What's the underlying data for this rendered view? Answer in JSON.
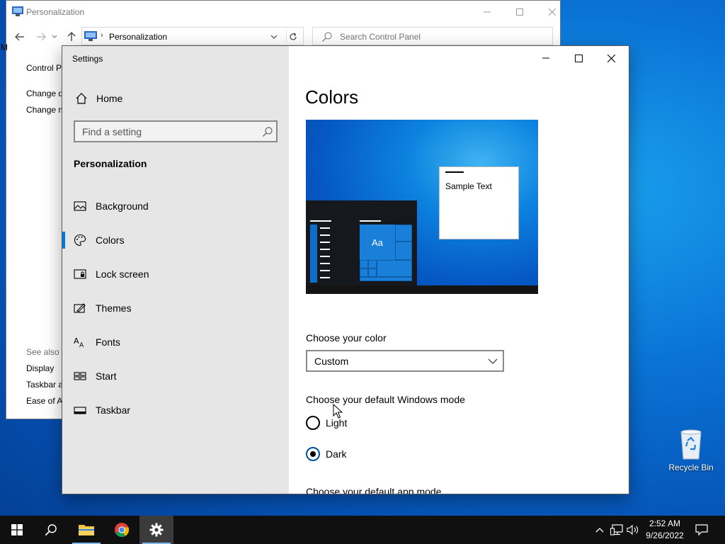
{
  "control_panel": {
    "title": "Personalization",
    "address_path": "Personalization",
    "search_placeholder": "Search Control Panel",
    "sidebar_home": "Control P",
    "sidebar_links": [
      "Change d",
      "Change m"
    ],
    "see_also_label": "See also",
    "see_also_links": [
      "Display",
      "Taskbar ar",
      "Ease of Ac"
    ],
    "edge_glyph": "M"
  },
  "settings": {
    "window_title": "Settings",
    "home_label": "Home",
    "search_placeholder": "Find a setting",
    "section_heading": "Personalization",
    "nav_items": [
      {
        "label": "Background",
        "icon": "picture-icon"
      },
      {
        "label": "Colors",
        "icon": "palette-icon"
      },
      {
        "label": "Lock screen",
        "icon": "lock-screen-icon"
      },
      {
        "label": "Themes",
        "icon": "themes-icon"
      },
      {
        "label": "Fonts",
        "icon": "fonts-icon"
      },
      {
        "label": "Start",
        "icon": "start-icon"
      },
      {
        "label": "Taskbar",
        "icon": "taskbar-icon"
      }
    ],
    "selected_nav": "Colors",
    "page_title": "Colors",
    "preview": {
      "tile_text": "Aa",
      "sample_text": "Sample Text"
    },
    "choose_color_label": "Choose your color",
    "choose_color_value": "Custom",
    "windows_mode_label": "Choose your default Windows mode",
    "windows_mode_options": [
      {
        "label": "Light",
        "checked": false
      },
      {
        "label": "Dark",
        "checked": true
      }
    ],
    "app_mode_label": "Choose your default app mode"
  },
  "desktop": {
    "recycle_bin_label": "Recycle Bin"
  },
  "taskbar": {
    "clock_time": "2:52 AM",
    "clock_date": "9/26/2022"
  },
  "colors": {
    "accent": "#0078d7",
    "sidebar_bg": "#e6e6e6",
    "taskbar_bg": "#101010"
  }
}
